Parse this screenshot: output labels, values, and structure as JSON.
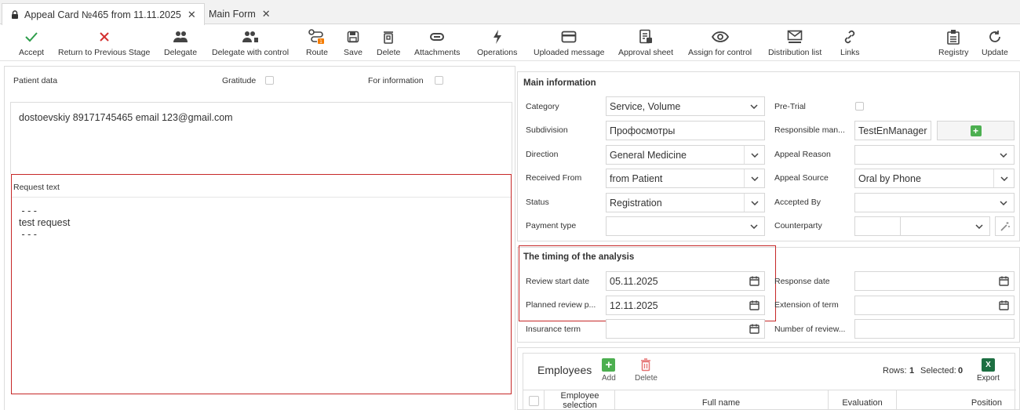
{
  "tabs": [
    {
      "label": "Appeal Card №465 from 11.11.2025",
      "active": true
    },
    {
      "label": "Main Form",
      "active": false
    }
  ],
  "toolbar": {
    "accept": "Accept",
    "return": "Return to Previous Stage",
    "delegate": "Delegate",
    "delegate_control": "Delegate with control",
    "route": "Route",
    "save": "Save",
    "delete": "Delete",
    "attachments": "Attachments",
    "operations": "Operations",
    "uploaded": "Uploaded message",
    "approval": "Approval sheet",
    "assign": "Assign for control",
    "distribution": "Distribution list",
    "links": "Links",
    "registry": "Registry",
    "update": "Update"
  },
  "left": {
    "patient_label": "Patient data",
    "gratitude_label": "Gratitude",
    "info_label": "For information",
    "patient_text": "dostoevskiy 89171745465 email 123@gmail.com",
    "request_label": "Request text",
    "request_text": " - - -\ntest request\n - - -"
  },
  "main": {
    "title": "Main information",
    "category_label": "Category",
    "category_value": "Service, Volume",
    "subdivision_label": "Subdivision",
    "subdivision_value": "Профосмотры",
    "direction_label": "Direction",
    "direction_value": "General Medicine",
    "received_label": "Received From",
    "received_value": "from Patient",
    "status_label": "Status",
    "status_value": "Registration",
    "payment_label": "Payment type",
    "payment_value": "",
    "pretrial_label": "Pre-Trial",
    "responsible_label": "Responsible man...",
    "responsible_value": "TestEnManager",
    "reason_label": "Appeal Reason",
    "reason_value": "",
    "source_label": "Appeal Source",
    "source_value": "Oral by Phone",
    "accepted_label": "Accepted By",
    "accepted_value": "",
    "counterparty_label": "Counterparty",
    "counterparty_value": ""
  },
  "timing": {
    "title": "The timing of the analysis",
    "review_start_label": "Review start date",
    "review_start_value": "05.11.2025",
    "planned_label": "Planned review p...",
    "planned_value": "12.11.2025",
    "insurance_label": "Insurance term",
    "insurance_value": "",
    "response_label": "Response date",
    "response_value": "",
    "extension_label": "Extension of term",
    "extension_value": "",
    "number_label": "Number of review...",
    "number_value": ""
  },
  "employees": {
    "title": "Employees",
    "add": "Add",
    "delete": "Delete",
    "rows_label": "Rows:",
    "rows_value": "1",
    "selected_label": "Selected:",
    "selected_value": "0",
    "export": "Export",
    "col_selection": "Employee selection",
    "col_fullname": "Full name",
    "col_evaluation": "Evaluation",
    "col_position": "Position"
  },
  "colors": {
    "accent_green": "#4caf50",
    "danger_red": "#c62828",
    "accept_green": "#2e9d4b"
  }
}
